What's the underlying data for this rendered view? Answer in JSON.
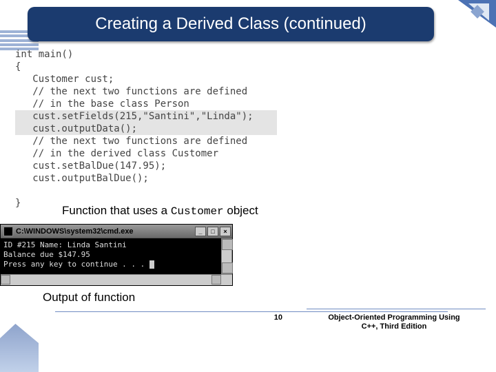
{
  "title": "Creating a Derived Class (continued)",
  "code": {
    "l1": "int main()",
    "l2": "{",
    "l3": "   Customer cust;",
    "l4": "   // the next two functions are defined",
    "l5": "   // in the base class Person",
    "l6": "   cust.setFields(215,\"Santini\",\"Linda\");",
    "l7": "   cust.outputData();",
    "l8": "   // the next two functions are defined",
    "l9": "   // in the derived class Customer",
    "l10": "   cust.setBalDue(147.95);",
    "l11": "   cust.outputBalDue();",
    "l12": "}"
  },
  "caption1_a": "Function that uses a ",
  "caption1_b": "Customer",
  "caption1_c": " object",
  "cmd": {
    "title": "C:\\WINDOWS\\system32\\cmd.exe",
    "line1": "ID #215 Name: Linda Santini",
    "line2": "Balance due $147.95",
    "line3": "Press any key to continue . . . "
  },
  "caption2": "Output of function",
  "page_num": "10",
  "footer_l1": "Object-Oriented Programming Using",
  "footer_l2": "C++, Third Edition"
}
